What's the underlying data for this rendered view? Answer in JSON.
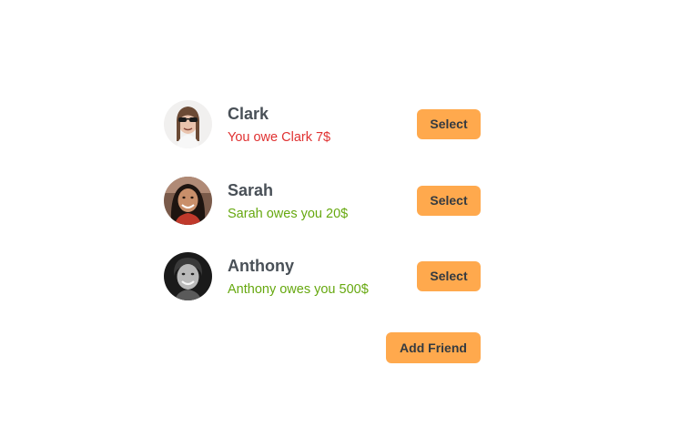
{
  "friends": [
    {
      "name": "Clark",
      "balance_text": "You owe Clark 7$",
      "balance_type": "owe",
      "select_label": "Select"
    },
    {
      "name": "Sarah",
      "balance_text": "Sarah owes you 20$",
      "balance_type": "owed",
      "select_label": "Select"
    },
    {
      "name": "Anthony",
      "balance_text": "Anthony owes you 500$",
      "balance_type": "owed",
      "select_label": "Select"
    }
  ],
  "add_friend_label": "Add Friend",
  "colors": {
    "accent": "#ffa94d",
    "owe": "#e03131",
    "owed": "#66a80f",
    "name_text": "#495057"
  }
}
